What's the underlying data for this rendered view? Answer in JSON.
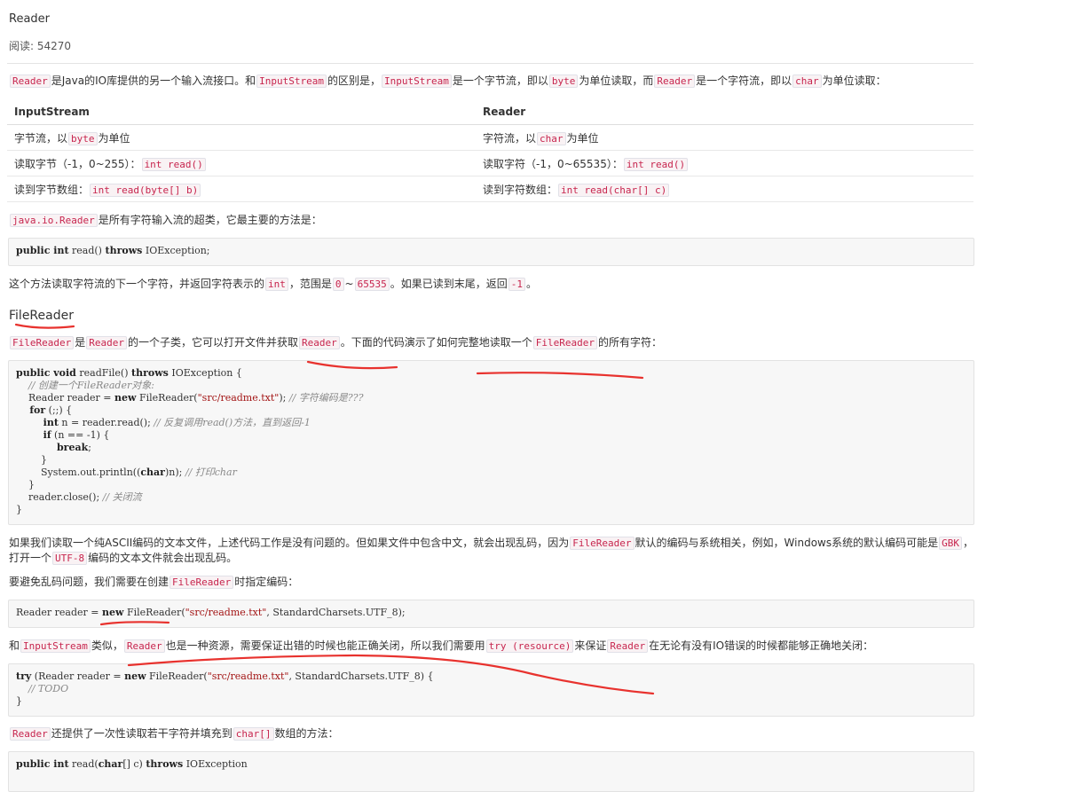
{
  "page": {
    "title": "Reader",
    "reads_label": "阅读:",
    "reads_count": "54270"
  },
  "intro": {
    "c1": "Reader",
    "t1": "是Java的IO库提供的另一个输入流接口。和",
    "c2": "InputStream",
    "t2": "的区别是，",
    "c3": "InputStream",
    "t3": "是一个字节流，即以",
    "c4": "byte",
    "t4": "为单位读取，而",
    "c5": "Reader",
    "t5": "是一个字符流，即以",
    "c6": "char",
    "t6": "为单位读取："
  },
  "table": {
    "headers": [
      "InputStream",
      "Reader"
    ],
    "rows": [
      {
        "a_pre": "字节流，以",
        "a_code": "byte",
        "a_post": "为单位",
        "b_pre": "字符流，以",
        "b_code": "char",
        "b_post": "为单位"
      },
      {
        "a_pre": "读取字节（-1，0~255）：",
        "a_code": "int read()",
        "a_post": "",
        "b_pre": "读取字符（-1，0~65535）：",
        "b_code": "int read()",
        "b_post": ""
      },
      {
        "a_pre": "读到字节数组：",
        "a_code": "int read(byte[] b)",
        "a_post": "",
        "b_pre": "读到字符数组：",
        "b_code": "int read(char[] c)",
        "b_post": ""
      }
    ]
  },
  "p_super": {
    "c1": "java.io.Reader",
    "t1": "是所有字符输入流的超类，它最主要的方法是："
  },
  "code1": {
    "kw1": "public int",
    "t1": " read() ",
    "kw2": "throws",
    "t2": " IOException;"
  },
  "p_read": {
    "t1": "这个方法读取字符流的下一个字符，并返回字符表示的",
    "c1": "int",
    "t2": "，范围是",
    "c2": "0",
    "t3": "~",
    "c3": "65535",
    "t4": "。如果已读到末尾，返回",
    "c4": "-1",
    "t5": "。"
  },
  "filereader_heading": "FileReader",
  "p_fr": {
    "c1": "FileReader",
    "t1": "是",
    "c2": "Reader",
    "t2": "的一个子类，它可以打开文件并获取",
    "c3": "Reader",
    "t3": "。下面的代码演示了如何完整地读取一个",
    "c4": "FileReader",
    "t4": "的所有字符："
  },
  "code2": {
    "l1_kw": "public void",
    "l1_t": " readFile() ",
    "l1_kw2": "throws",
    "l1_t2": " IOException {",
    "l2_cm": "    // 创建一个FileReader对象:",
    "l3_t": "    Reader reader = ",
    "l3_kw": "new",
    "l3_t2": " FileReader(",
    "l3_st": "\"src/readme.txt\"",
    "l3_t3": "); ",
    "l3_cm": "// 字符编码是???",
    "l4_kw": "    for",
    "l4_t": " (;;) {",
    "l5_kw": "        int",
    "l5_t": " n = reader.read(); ",
    "l5_cm": "// 反复调用read()方法，直到返回-1",
    "l6_kw": "        if",
    "l6_t": " (n == -1) {",
    "l7_kw": "            break",
    "l7_t": ";",
    "l8_t": "        }",
    "l9_t": "        System.out.println((",
    "l9_kw": "char",
    "l9_t2": ")n); ",
    "l9_cm": "// 打印char",
    "l10_t": "    }",
    "l11_t": "    reader.close(); ",
    "l11_cm": "// 关闭流",
    "l12_t": "}"
  },
  "p_ascii": {
    "t1": "如果我们读取一个纯ASCII编码的文本文件，上述代码工作是没有问题的。但如果文件中包含中文，就会出现乱码，因为",
    "c1": "FileReader",
    "t2": "默认的编码与系统相关，例如，Windows系统的默认编码可能是",
    "c2": "GBK",
    "t3": "，",
    "t4": "打开一个",
    "c3": "UTF-8",
    "t5": "编码的文本文件就会出现乱码。"
  },
  "p_avoid": {
    "t1": "要避免乱码问题，我们需要在创建",
    "c1": "FileReader",
    "t2": "时指定编码："
  },
  "code3": {
    "t1": "Reader reader = ",
    "kw": "new",
    "t2": " FileReader(",
    "st": "\"src/readme.txt\"",
    "t3": ", StandardCharsets.UTF_8);"
  },
  "p_res": {
    "t1": "和",
    "c1": "InputStream",
    "t2": "类似，",
    "c2": "Reader",
    "t3": "也是一种资源，需要保证出错的时候也能正确关闭，所以我们需要用",
    "c3": "try (resource)",
    "t4": "来保证",
    "c4": "Reader",
    "t5": "在无论有没有IO错误的时候都能够正确地关闭："
  },
  "code4": {
    "l1_kw": "try",
    "l1_t": " (Reader reader = ",
    "l1_kw2": "new",
    "l1_t2": " FileReader(",
    "l1_st": "\"src/readme.txt\"",
    "l1_t3": ", StandardCharsets.UTF_8) {",
    "l2_cm": "    // TODO",
    "l3_t": "}"
  },
  "p_arr": {
    "c1": "Reader",
    "t1": "还提供了一次性读取若干字符并填充到",
    "c2": "char[]",
    "t2": "数组的方法："
  },
  "code5": {
    "kw1": "public int",
    "t1": " read(",
    "kw2": "char",
    "t2": "[] c) ",
    "kw3": "throws",
    "t3": " IOException"
  },
  "annotation_color": "#e8322e"
}
